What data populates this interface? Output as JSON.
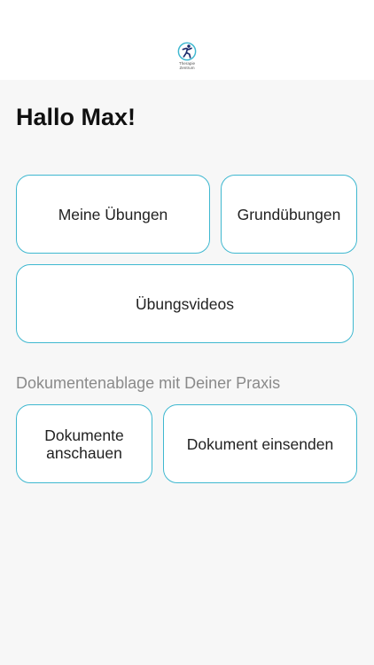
{
  "header": {
    "logo_line1": "Therapie",
    "logo_line2": "Zentrum",
    "brand_color": "#3fb8d0"
  },
  "greeting": "Hallo Max!",
  "exercises": {
    "my_exercises": "Meine Übungen",
    "basic_exercises": "Grundübungen",
    "videos": "Übungsvideos"
  },
  "documents": {
    "section_title": "Dokumentenablage mit Deiner Praxis",
    "view_line1": "Dokumente",
    "view_line2": "anschauen",
    "send": "Dokument einsenden"
  }
}
